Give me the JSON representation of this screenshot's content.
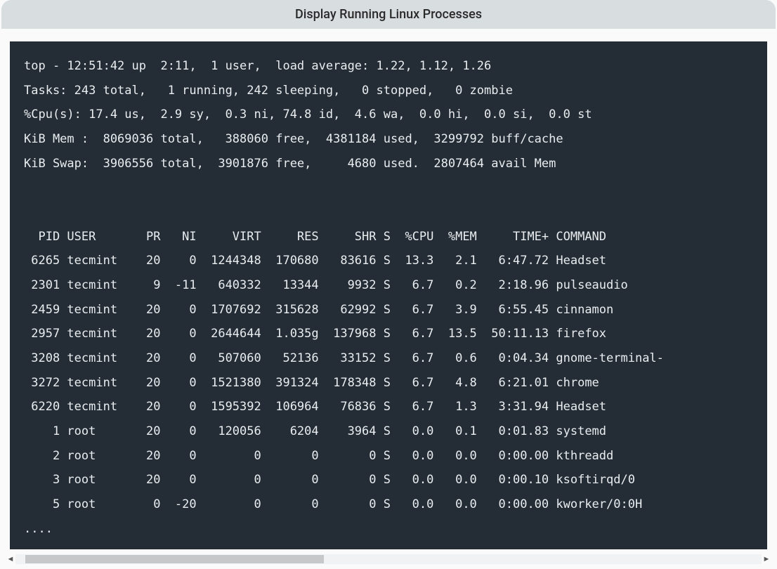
{
  "caption": "Display Running Linux Processes",
  "header": {
    "time_line": "top - 12:51:42 up  2:11,  1 user,  load average: 1.22, 1.12, 1.26",
    "tasks_line": "Tasks: 243 total,   1 running, 242 sleeping,   0 stopped,   0 zombie",
    "cpu_line": "%Cpu(s): 17.4 us,  2.9 sy,  0.3 ni, 74.8 id,  4.6 wa,  0.0 hi,  0.0 si,  0.0 st",
    "mem_line": "KiB Mem :  8069036 total,   388060 free,  4381184 used,  3299792 buff/cache",
    "swap_line": "KiB Swap:  3906556 total,  3901876 free,     4680 used.  2807464 avail Mem"
  },
  "columns": [
    "PID",
    "USER",
    "PR",
    "NI",
    "VIRT",
    "RES",
    "SHR",
    "S",
    "%CPU",
    "%MEM",
    "TIME+",
    "COMMAND"
  ],
  "rows": [
    {
      "pid": "6265",
      "user": "tecmint",
      "pr": "20",
      "ni": "0",
      "virt": "1244348",
      "res": "170680",
      "shr": "83616",
      "s": "S",
      "cpu": "13.3",
      "mem": "2.1",
      "time": "6:47.72",
      "cmd": "Headset"
    },
    {
      "pid": "2301",
      "user": "tecmint",
      "pr": "9",
      "ni": "-11",
      "virt": "640332",
      "res": "13344",
      "shr": "9932",
      "s": "S",
      "cpu": "6.7",
      "mem": "0.2",
      "time": "2:18.96",
      "cmd": "pulseaudio"
    },
    {
      "pid": "2459",
      "user": "tecmint",
      "pr": "20",
      "ni": "0",
      "virt": "1707692",
      "res": "315628",
      "shr": "62992",
      "s": "S",
      "cpu": "6.7",
      "mem": "3.9",
      "time": "6:55.45",
      "cmd": "cinnamon"
    },
    {
      "pid": "2957",
      "user": "tecmint",
      "pr": "20",
      "ni": "0",
      "virt": "2644644",
      "res": "1.035g",
      "shr": "137968",
      "s": "S",
      "cpu": "6.7",
      "mem": "13.5",
      "time": "50:11.13",
      "cmd": "firefox"
    },
    {
      "pid": "3208",
      "user": "tecmint",
      "pr": "20",
      "ni": "0",
      "virt": "507060",
      "res": "52136",
      "shr": "33152",
      "s": "S",
      "cpu": "6.7",
      "mem": "0.6",
      "time": "0:04.34",
      "cmd": "gnome-terminal-"
    },
    {
      "pid": "3272",
      "user": "tecmint",
      "pr": "20",
      "ni": "0",
      "virt": "1521380",
      "res": "391324",
      "shr": "178348",
      "s": "S",
      "cpu": "6.7",
      "mem": "4.8",
      "time": "6:21.01",
      "cmd": "chrome"
    },
    {
      "pid": "6220",
      "user": "tecmint",
      "pr": "20",
      "ni": "0",
      "virt": "1595392",
      "res": "106964",
      "shr": "76836",
      "s": "S",
      "cpu": "6.7",
      "mem": "1.3",
      "time": "3:31.94",
      "cmd": "Headset"
    },
    {
      "pid": "1",
      "user": "root",
      "pr": "20",
      "ni": "0",
      "virt": "120056",
      "res": "6204",
      "shr": "3964",
      "s": "S",
      "cpu": "0.0",
      "mem": "0.1",
      "time": "0:01.83",
      "cmd": "systemd"
    },
    {
      "pid": "2",
      "user": "root",
      "pr": "20",
      "ni": "0",
      "virt": "0",
      "res": "0",
      "shr": "0",
      "s": "S",
      "cpu": "0.0",
      "mem": "0.0",
      "time": "0:00.00",
      "cmd": "kthreadd"
    },
    {
      "pid": "3",
      "user": "root",
      "pr": "20",
      "ni": "0",
      "virt": "0",
      "res": "0",
      "shr": "0",
      "s": "S",
      "cpu": "0.0",
      "mem": "0.0",
      "time": "0:00.10",
      "cmd": "ksoftirqd/0"
    },
    {
      "pid": "5",
      "user": "root",
      "pr": "0",
      "ni": "-20",
      "virt": "0",
      "res": "0",
      "shr": "0",
      "s": "S",
      "cpu": "0.0",
      "mem": "0.0",
      "time": "0:00.00",
      "cmd": "kworker/0:0H"
    }
  ],
  "trailing": "....",
  "scrollbar": {
    "left_arrow": "◄",
    "right_arrow": "►"
  }
}
